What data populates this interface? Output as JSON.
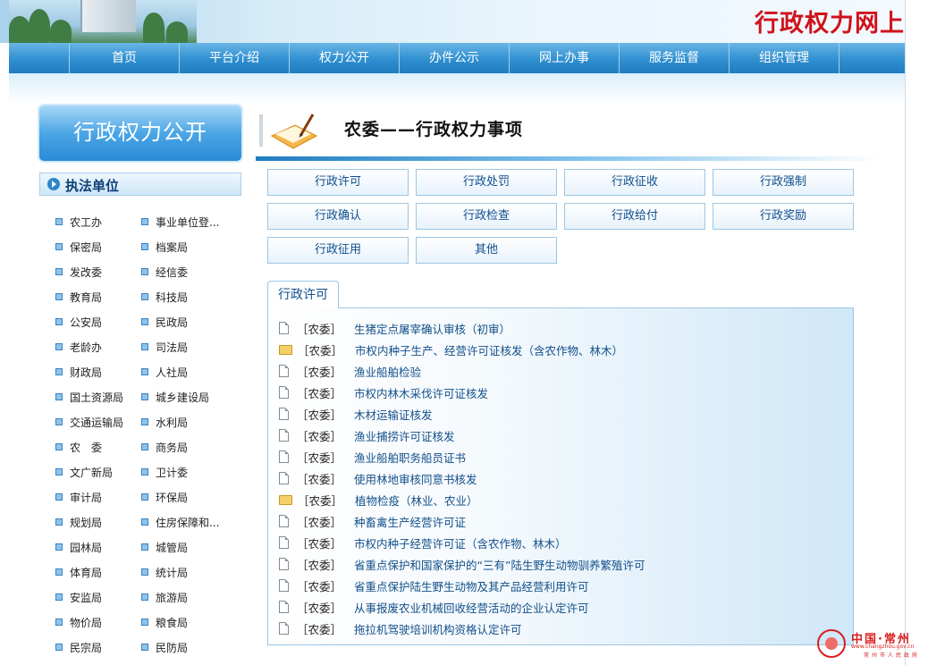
{
  "header": {
    "site_title": "行政权力网上"
  },
  "nav": {
    "items": [
      "首页",
      "平台介绍",
      "权力公开",
      "办件公示",
      "网上办事",
      "服务监督",
      "组织管理"
    ]
  },
  "sidebar": {
    "heading": "行政权力公开",
    "subheading": "执法单位",
    "units": [
      "农工办",
      "事业单位登...",
      "保密局",
      "档案局",
      "发改委",
      "经信委",
      "教育局",
      "科技局",
      "公安局",
      "民政局",
      "老龄办",
      "司法局",
      "财政局",
      "人社局",
      "国土资源局",
      "城乡建设局",
      "交通运输局",
      "水利局",
      "农　委",
      "商务局",
      "文广新局",
      "卫计委",
      "审计局",
      "环保局",
      "规划局",
      "住房保障和...",
      "园林局",
      "城管局",
      "体育局",
      "统计局",
      "安监局",
      "旅游局",
      "物价局",
      "粮食局",
      "民宗局",
      "民防局"
    ]
  },
  "main": {
    "title": "农委——行政权力事项",
    "categories": [
      "行政许可",
      "行政处罚",
      "行政征收",
      "行政强制",
      "行政确认",
      "行政检查",
      "行政给付",
      "行政奖励",
      "行政征用",
      "其他"
    ],
    "active_tab": "行政许可",
    "items": [
      {
        "tag": "［农委］",
        "title": "生猪定点屠宰确认审核（初审）",
        "icon": "document-icon"
      },
      {
        "tag": "［农委］",
        "title": "市权内种子生产、经营许可证核发（含农作物、林木）",
        "icon": "folder-icon"
      },
      {
        "tag": "［农委］",
        "title": "渔业船舶检验",
        "icon": "document-icon"
      },
      {
        "tag": "［农委］",
        "title": "市权内林木采伐许可证核发",
        "icon": "document-icon"
      },
      {
        "tag": "［农委］",
        "title": "木材运输证核发",
        "icon": "document-icon"
      },
      {
        "tag": "［农委］",
        "title": "渔业捕捞许可证核发",
        "icon": "document-icon"
      },
      {
        "tag": "［农委］",
        "title": "渔业船舶职务船员证书",
        "icon": "document-icon"
      },
      {
        "tag": "［农委］",
        "title": "使用林地审核同意书核发",
        "icon": "document-icon"
      },
      {
        "tag": "［农委］",
        "title": "植物检疫（林业、农业）",
        "icon": "folder-icon"
      },
      {
        "tag": "［农委］",
        "title": "种畜禽生产经营许可证",
        "icon": "document-icon"
      },
      {
        "tag": "［农委］",
        "title": "市权内种子经营许可证（含农作物、林木）",
        "icon": "document-icon"
      },
      {
        "tag": "［农委］",
        "title": "省重点保护和国家保护的“三有”陆生野生动物驯养繁殖许可",
        "icon": "document-icon"
      },
      {
        "tag": "［农委］",
        "title": "省重点保护陆生野生动物及其产品经营利用许可",
        "icon": "document-icon"
      },
      {
        "tag": "［农委］",
        "title": "从事报废农业机械回收经营活动的企业认定许可",
        "icon": "document-icon"
      },
      {
        "tag": "［农委］",
        "title": "拖拉机驾驶培训机构资格认定许可",
        "icon": "document-icon"
      }
    ]
  },
  "footer": {
    "logo_line1": "中国·常州",
    "logo_url_text": "www.changzhou.gov.cn",
    "logo_line3": "常州市人民政府"
  },
  "colors": {
    "nav_blue": "#2f8fd0",
    "title_red": "#d0121b",
    "link_blue": "#114f89"
  }
}
